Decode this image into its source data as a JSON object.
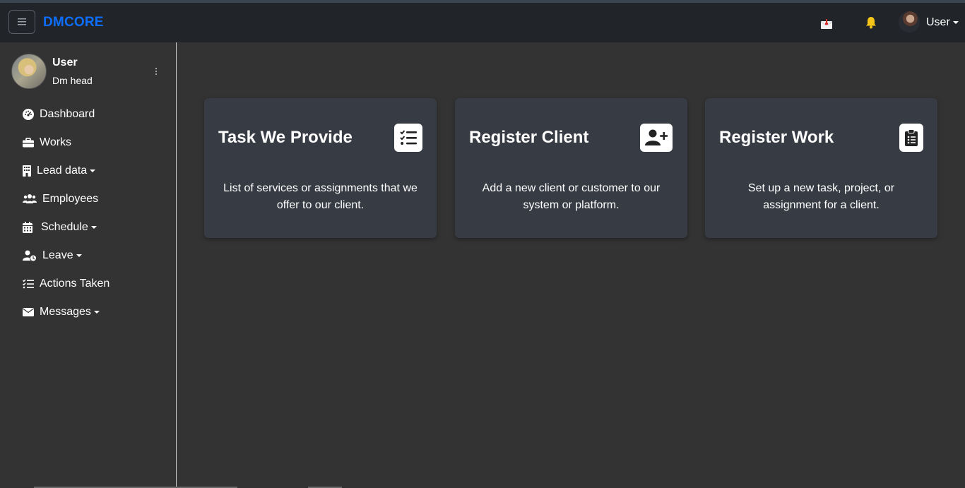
{
  "navbar": {
    "brand": "DMCORE",
    "user_label": "User",
    "brand_color": "#0d6efd"
  },
  "profile": {
    "name": "User",
    "role": "Dm head"
  },
  "sidebar": {
    "items": [
      {
        "label": "Dashboard",
        "icon": "dashboard-gauge-icon",
        "dropdown": false
      },
      {
        "label": "Works",
        "icon": "briefcase-icon",
        "dropdown": false
      },
      {
        "label": "Lead data",
        "icon": "building-icon",
        "dropdown": true
      },
      {
        "label": "Employees",
        "icon": "users-icon",
        "dropdown": false
      },
      {
        "label": "Schedule",
        "icon": "calendar-icon",
        "dropdown": true
      },
      {
        "label": "Leave",
        "icon": "user-clock-icon",
        "dropdown": true
      },
      {
        "label": "Actions Taken",
        "icon": "list-check-icon",
        "dropdown": false
      },
      {
        "label": "Messages",
        "icon": "envelope-icon",
        "dropdown": true
      }
    ]
  },
  "cards": [
    {
      "title": "Task We Provide",
      "text": "List of services or assignments that we offer to our client.",
      "icon": "list-check-icon"
    },
    {
      "title": "Register Client",
      "text": "Add a new client or customer to our system or platform.",
      "icon": "user-plus-icon"
    },
    {
      "title": "Register Work",
      "text": "Set up a new task, project, or assignment for a client.",
      "icon": "clipboard-list-icon"
    }
  ]
}
